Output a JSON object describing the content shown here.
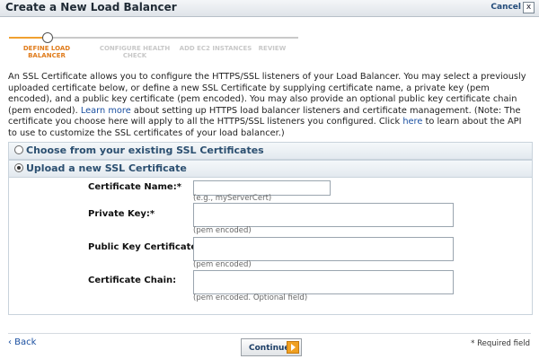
{
  "header": {
    "title": "Create a New Load Balancer",
    "cancel_label": "Cancel",
    "close_glyph": "x"
  },
  "wizard": {
    "steps": [
      {
        "label": "DEFINE LOAD BALANCER",
        "state": "active"
      },
      {
        "label": "CONFIGURE HEALTH CHECK",
        "state": "pending"
      },
      {
        "label": "ADD EC2 INSTANCES",
        "state": "pending"
      },
      {
        "label": "REVIEW",
        "state": "pending"
      }
    ],
    "accent_color": "#e07b1a"
  },
  "intro": {
    "text1": "An SSL Certificate allows you to configure the HTTPS/SSL listeners of your Load Balancer. You may select a previously uploaded certificate below, or define a new SSL Certificate by supplying certificate name, a private key (pem encoded), and a public key certificate (pem encoded). You may also provide an optional public key certificate chain (pem encoded). ",
    "learn_more_link": "Learn more",
    "text2": " about setting up HTTPS load balancer listeners and certificate management. (Note: The certificate you choose here will apply to all the HTTPS/SSL listeners you configured. Click ",
    "here_link": "here",
    "text3": " to learn about the API to use to customize the SSL certificates of your load balancer.)"
  },
  "options": {
    "existing_label": "Choose from your existing SSL Certificates",
    "upload_label": "Upload a new SSL Certificate",
    "selected": "upload"
  },
  "form": {
    "cert_name_label": "Certificate Name:*",
    "cert_name_hint": "(e.g., myServerCert)",
    "cert_name_value": "",
    "private_key_label": "Private Key:*",
    "private_key_hint": "(pem encoded)",
    "public_key_label": "Public Key Certificate:*",
    "public_key_hint": "(pem encoded)",
    "chain_label": "Certificate Chain:",
    "chain_hint": "(pem encoded. Optional field)"
  },
  "footer": {
    "back_label": "‹ Back",
    "continue_label": "Continue",
    "required_note": "* Required field"
  }
}
